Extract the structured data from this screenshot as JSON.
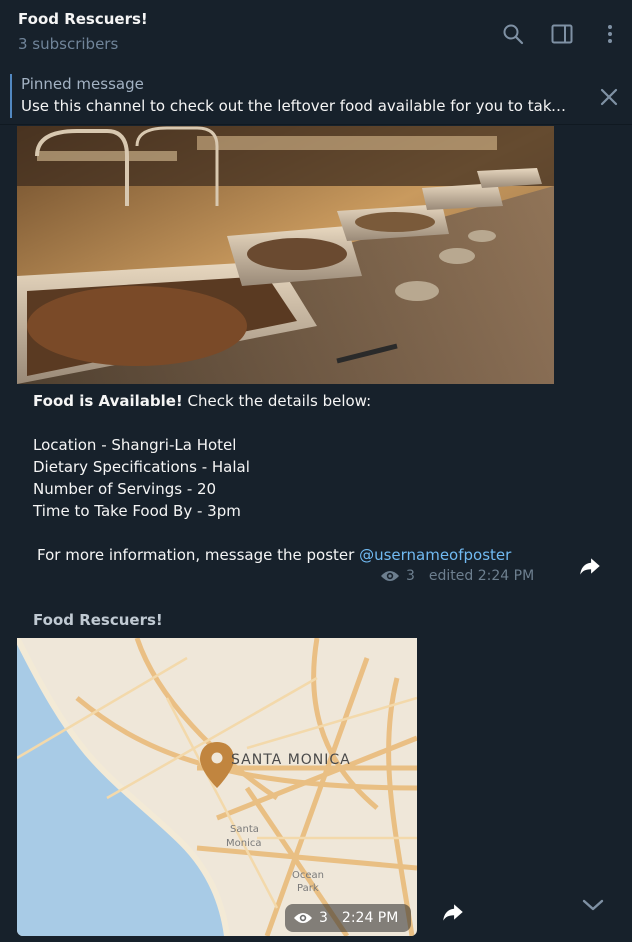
{
  "header": {
    "title": "Food Rescuers!",
    "subtitle": "3 subscribers",
    "icons": [
      "search-icon",
      "sidebar-toggle-icon",
      "more-options-icon"
    ]
  },
  "pinned": {
    "label": "Pinned message",
    "text": "Use this channel to check out the leftover food available for you to take..."
  },
  "post1": {
    "bold_lead": "Food is Available!",
    "lead_rest": " Check the details below:",
    "location": "Location - Shangri-La Hotel",
    "dietary": "Dietary Specifications - Halal",
    "servings": "Number of Servings - 20",
    "time": "Time to Take Food By - 3pm",
    "info_prefix": "For more information, message the poster ",
    "mention": "@usernameofposter",
    "views": "3",
    "edited": "edited 2:24 PM"
  },
  "post2": {
    "sender": "Food Rescuers!",
    "map_city": "SANTA MONICA",
    "map_label_santa": "Santa",
    "map_label_monica": "Monica",
    "map_label_ocean": "Ocean",
    "map_label_park": "Park",
    "views": "3",
    "time": "2:24 PM"
  },
  "colors": {
    "background": "#17212b",
    "accent": "#5288c1",
    "link": "#71baf2",
    "muted": "#708499"
  }
}
